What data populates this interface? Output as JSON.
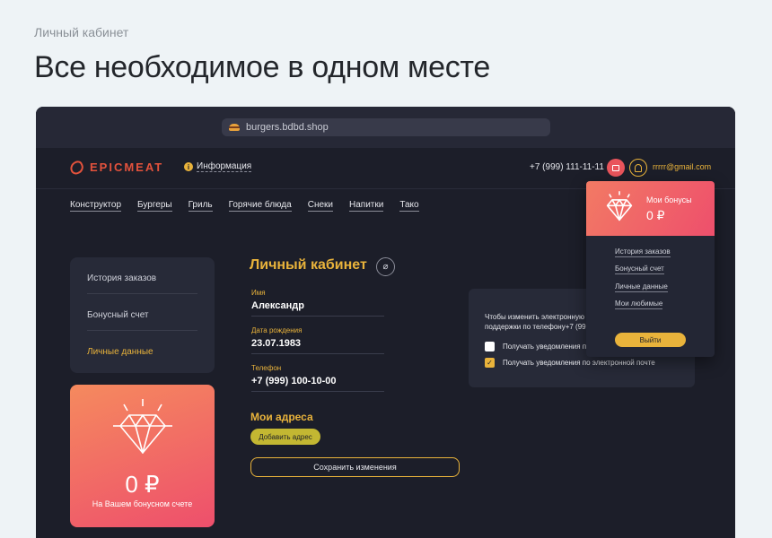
{
  "page": {
    "caption": "Личный кабинет",
    "headline": "Все необходимое в одном месте"
  },
  "browser": {
    "url": "burgers.bdbd.shop",
    "favicon": "burger-icon"
  },
  "header": {
    "logo": "EPICMEAT",
    "info_label": "Информация",
    "phone": "+7 (999) 111-11-11",
    "email": "rrrrr@gmail.com"
  },
  "nav": {
    "items": [
      "Конструктор",
      "Бургеры",
      "Гриль",
      "Горячие блюда",
      "Снеки",
      "Напитки",
      "Тако"
    ]
  },
  "sidebar": {
    "items": [
      {
        "label": "История заказов",
        "active": false
      },
      {
        "label": "Бонусный счет",
        "active": false
      },
      {
        "label": "Личные данные",
        "active": true
      }
    ]
  },
  "bonus_card": {
    "amount": "0 ₽",
    "caption": "На Вашем бонусном счете"
  },
  "profile": {
    "title": "Личный кабинет",
    "fields": [
      {
        "label": "Имя",
        "value": "Александр"
      },
      {
        "label": "Дата рождения",
        "value": "23.07.1983"
      },
      {
        "label": "Телефон",
        "value": "+7 (999) 100-10-00"
      }
    ],
    "addresses_title": "Мои адреса",
    "add_address_label": "Добавить адрес",
    "save_label": "Сохранить изменения"
  },
  "notifications": {
    "text_line1": "Чтобы изменить электронную п",
    "text_line2": "поддержки по телефону+7 (999)",
    "options": [
      {
        "label": "Получать уведомления по",
        "checked": false
      },
      {
        "label": "Получать уведомления по электронной почте",
        "checked": true
      }
    ]
  },
  "dropdown": {
    "title": "Мои бонусы",
    "amount": "0 ₽",
    "items": [
      "История заказов",
      "Бонусный счет",
      "Личные данные",
      "Мои любимые"
    ],
    "logout_label": "Выйти"
  },
  "colors": {
    "accent": "#e9b33b",
    "brand": "#e3523c",
    "background": "#1c1e29",
    "card": "#272a38",
    "gradient_start": "#f58a5e",
    "gradient_end": "#ee4f6c"
  }
}
